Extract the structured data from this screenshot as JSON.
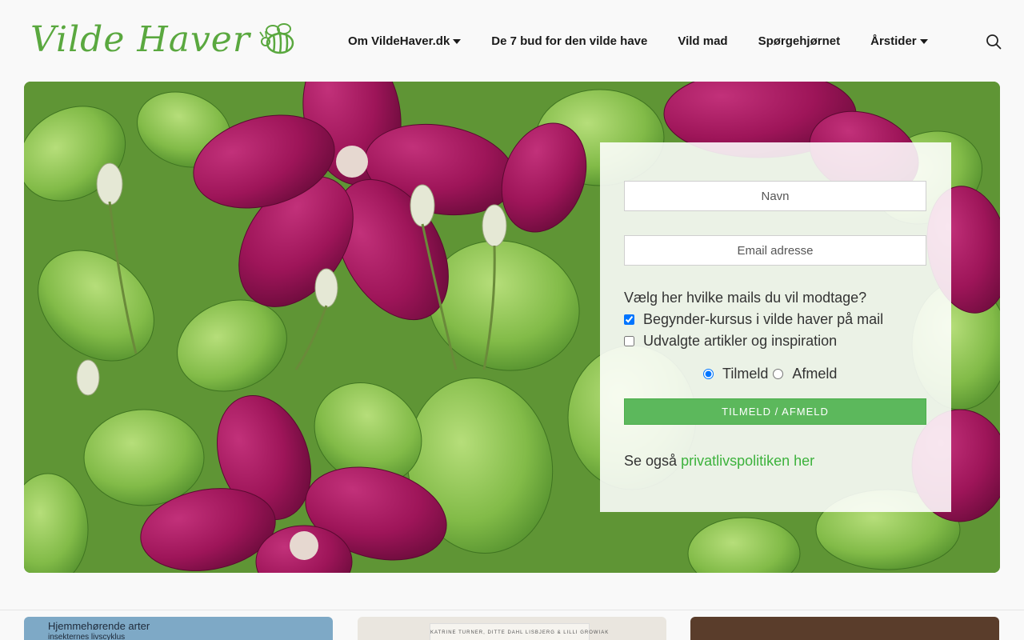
{
  "header": {
    "logo_text": "Vilde Haver",
    "nav": [
      {
        "label": "Om VildeHaver.dk",
        "has_dropdown": true
      },
      {
        "label": "De 7 bud for den vilde have",
        "has_dropdown": false
      },
      {
        "label": "Vild mad",
        "has_dropdown": false
      },
      {
        "label": "Spørgehjørnet",
        "has_dropdown": false
      },
      {
        "label": "Årstider",
        "has_dropdown": true
      }
    ],
    "search_icon": "search-icon"
  },
  "form": {
    "name_placeholder": "Navn",
    "email_placeholder": "Email adresse",
    "question": "Vælg her hvilke mails du vil modtage?",
    "options": [
      {
        "label": "Begynder-kursus i vilde haver på mail",
        "checked": true
      },
      {
        "label": "Udvalgte artikler og inspiration",
        "checked": false
      }
    ],
    "radio": [
      {
        "label": "Tilmeld",
        "selected": true
      },
      {
        "label": "Afmeld",
        "selected": false
      }
    ],
    "submit_label": "TILMELD / AFMELD",
    "privacy_prefix": "Se også",
    "privacy_link": "privatlivspolitiken her"
  },
  "thumbs": [
    {
      "title": "Hjemmehørende arter",
      "subtitle": "insekternes livscyklus"
    },
    {
      "title": "KATRINE TURNER, DITTE DAHL LISBJERG & LILLI GROWIAK"
    },
    {
      "title": ""
    }
  ],
  "colors": {
    "brand_green": "#5aa83f",
    "button_green": "#5cb85c",
    "link_green": "#3cb23c"
  }
}
